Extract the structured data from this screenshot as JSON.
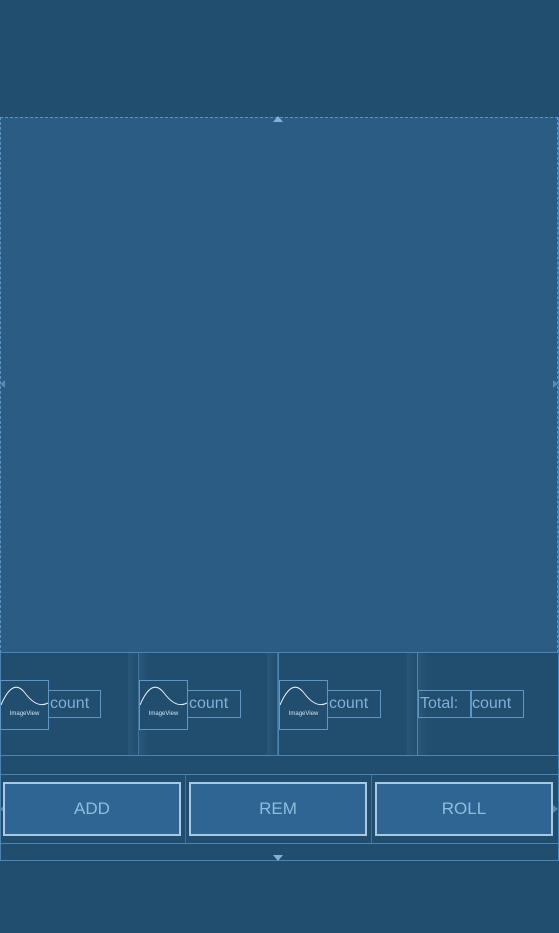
{
  "counters": [
    {
      "image_label": "ImageView",
      "count_label": "count"
    },
    {
      "image_label": "ImageView",
      "count_label": "count"
    },
    {
      "image_label": "ImageView",
      "count_label": "count"
    }
  ],
  "total": {
    "label": "Total:",
    "count_label": "count"
  },
  "buttons": {
    "add": "ADD",
    "remove": "REM",
    "roll": "ROLL"
  },
  "colors": {
    "background": "#214d6e",
    "canvas": "#2b5c84",
    "outline": "#5f96c4",
    "text": "#7fb0d8",
    "button_fill": "#2e6592",
    "button_border": "#a8c8e4"
  }
}
